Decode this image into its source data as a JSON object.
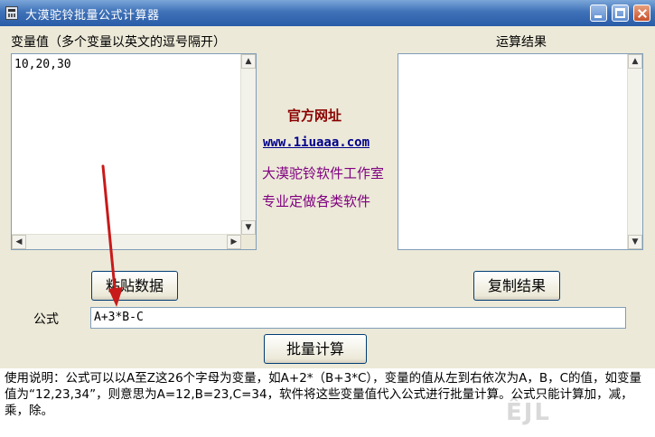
{
  "window": {
    "title": "大漠驼铃批量公式计算器"
  },
  "variables": {
    "label": "变量值（多个变量以英文的逗号隔开）",
    "value": "10,20,30"
  },
  "results": {
    "label": "运算结果",
    "value": ""
  },
  "info": {
    "official_site_label": "官方网址",
    "url": "www.1iuaaa.com",
    "studio": "大漠驼铃软件工作室",
    "slogan": "专业定做各类软件",
    "colors": {
      "heading": "#8b0000",
      "url": "#00008b",
      "studio": "#800080"
    }
  },
  "buttons": {
    "paste": "粘贴数据",
    "copy": "复制结果",
    "calculate": "批量计算"
  },
  "formula": {
    "label": "公式",
    "value": "A+3*B-C"
  },
  "instructions": "使用说明：公式可以以A至Z这26个字母为变量，如A+2*（B+3*C），变量的值从左到右依次为A，B，C的值，如变量值为“12,23,34”，则意思为A=12,B=23,C=34，软件将这些变量值代入公式进行批量计算。公式只能计算加，减，乘，除。",
  "scroll_icons": {
    "up": "▲",
    "down": "▼",
    "left": "◀",
    "right": "▶"
  },
  "watermark": "ÊJL"
}
